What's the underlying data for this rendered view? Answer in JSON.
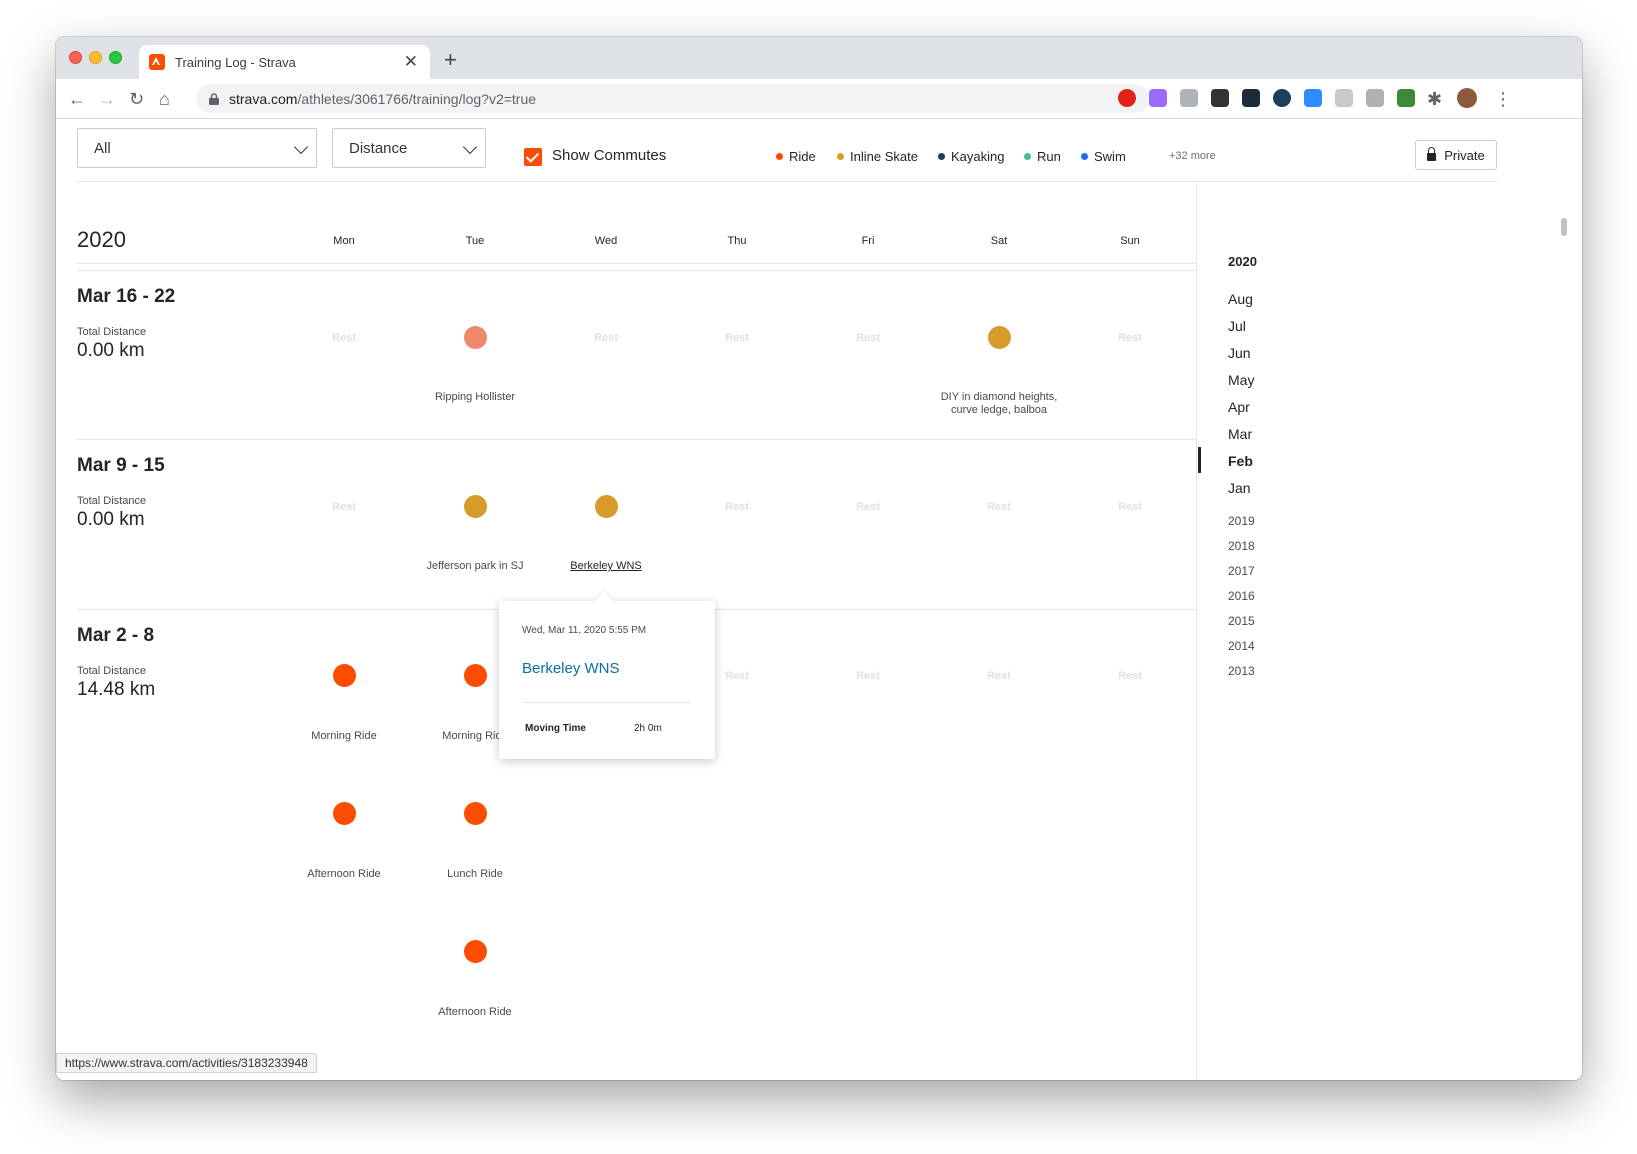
{
  "browser": {
    "tab_title": "Training Log - Strava",
    "url_host": "strava.com",
    "url_path": "/athletes/3061766/training/log?v2=true",
    "status_url": "https://www.strava.com/activities/3183233948"
  },
  "filters": {
    "sport": "All",
    "metric": "Distance",
    "commutes_label": "Show Commutes",
    "commutes_checked": true,
    "private_label": "Private"
  },
  "legend": [
    {
      "label": "Ride",
      "color": "#fc4c02"
    },
    {
      "label": "Inline Skate",
      "color": "#d69b2b"
    },
    {
      "label": "Kayaking",
      "color": "#1f3a5f"
    },
    {
      "label": "Run",
      "color": "#3fbf8f"
    },
    {
      "label": "Swim",
      "color": "#1a6cf0"
    }
  ],
  "legend_more": "+32 more",
  "log": {
    "year": "2020",
    "days": [
      "Mon",
      "Tue",
      "Wed",
      "Thu",
      "Fri",
      "Sat",
      "Sun"
    ],
    "rest_label": "Rest",
    "total_label": "Total Distance",
    "weeks": [
      {
        "title": "Mar 16 - 22",
        "total": "0.00 km"
      },
      {
        "title": "Mar 9 - 15",
        "total": "0.00 km"
      },
      {
        "title": "Mar 2 - 8",
        "total": "14.48 km"
      }
    ],
    "activities": {
      "w1_tue": "Ripping Hollister",
      "w1_sat_1": "DIY in diamond heights,",
      "w1_sat_2": "curve ledge, balboa",
      "w2_tue": "Jefferson park in SJ",
      "w2_wed": "Berkeley WNS",
      "w3_mon_1": "Morning Ride",
      "w3_tue_1": "Morning Ride",
      "w3_mon_2": "Afternoon Ride",
      "w3_tue_2": "Lunch Ride",
      "w3_tue_3": "Afternoon Ride"
    }
  },
  "tooltip": {
    "date": "Wed, Mar 11, 2020 5:55 PM",
    "title": "Berkeley WNS",
    "stat_label": "Moving Time",
    "stat_value": "2h 0m"
  },
  "sidebar": {
    "year": "2020",
    "months": [
      "Aug",
      "Jul",
      "Jun",
      "May",
      "Apr",
      "Mar",
      "Feb",
      "Jan"
    ],
    "active_month": "Feb",
    "years": [
      "2019",
      "2018",
      "2017",
      "2016",
      "2015",
      "2014",
      "2013"
    ]
  }
}
